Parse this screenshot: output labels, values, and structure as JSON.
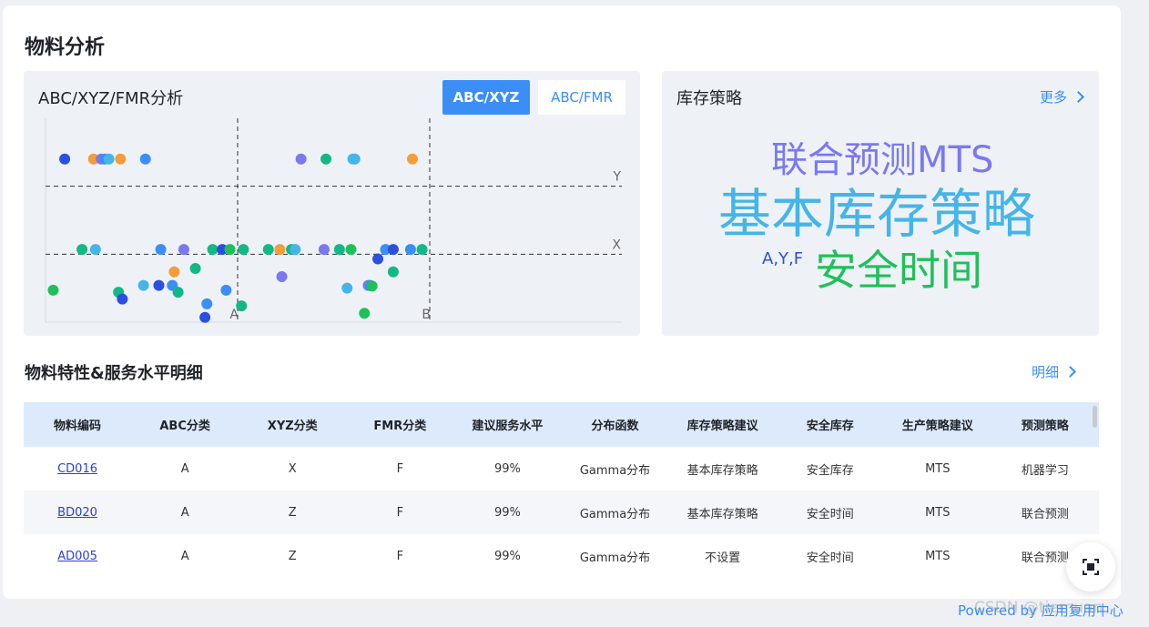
{
  "page": {
    "title": "物料分析"
  },
  "analysis": {
    "title": "ABC/XYZ/FMR分析",
    "tabs": [
      {
        "label": "ABC/XYZ",
        "active": true
      },
      {
        "label": "ABC/FMR",
        "active": false
      }
    ],
    "colors": {
      "active_tab": "#3a8ef6"
    }
  },
  "chart_data": {
    "type": "scatter",
    "x_category_labels": [
      "A",
      "B"
    ],
    "y_category_labels": [
      "X",
      "Y"
    ],
    "x_divider_values": [
      1,
      2
    ],
    "y_divider_values": [
      1,
      2
    ],
    "xlim": [
      0,
      3
    ],
    "ylim": [
      0,
      3
    ],
    "grid": false,
    "point_colors": [
      "#2b4fe0",
      "#3a8ef6",
      "#45b5e8",
      "#7b78f0",
      "#f59c3b",
      "#12b886",
      "#1fc05a"
    ],
    "points": [
      {
        "x": 0.1,
        "y": 2.4,
        "c": 0
      },
      {
        "x": 0.25,
        "y": 2.4,
        "c": 4
      },
      {
        "x": 0.29,
        "y": 2.4,
        "c": 3
      },
      {
        "x": 0.31,
        "y": 2.4,
        "c": 1
      },
      {
        "x": 0.33,
        "y": 2.4,
        "c": 2
      },
      {
        "x": 0.39,
        "y": 2.4,
        "c": 4
      },
      {
        "x": 0.52,
        "y": 2.4,
        "c": 1
      },
      {
        "x": 1.33,
        "y": 2.4,
        "c": 3
      },
      {
        "x": 1.46,
        "y": 2.4,
        "c": 5
      },
      {
        "x": 1.6,
        "y": 2.4,
        "c": 2
      },
      {
        "x": 1.61,
        "y": 2.4,
        "c": 2
      },
      {
        "x": 1.91,
        "y": 2.4,
        "c": 4
      },
      {
        "x": 0.19,
        "y": 1.07,
        "c": 5
      },
      {
        "x": 0.26,
        "y": 1.07,
        "c": 2
      },
      {
        "x": 0.6,
        "y": 1.07,
        "c": 1
      },
      {
        "x": 0.72,
        "y": 1.07,
        "c": 3
      },
      {
        "x": 0.87,
        "y": 1.07,
        "c": 5
      },
      {
        "x": 0.92,
        "y": 1.07,
        "c": 0
      },
      {
        "x": 0.96,
        "y": 1.07,
        "c": 6
      },
      {
        "x": 1.03,
        "y": 1.07,
        "c": 5
      },
      {
        "x": 1.16,
        "y": 1.07,
        "c": 5
      },
      {
        "x": 1.22,
        "y": 1.07,
        "c": 4
      },
      {
        "x": 1.28,
        "y": 1.07,
        "c": 5
      },
      {
        "x": 1.3,
        "y": 1.07,
        "c": 2
      },
      {
        "x": 1.45,
        "y": 1.07,
        "c": 3
      },
      {
        "x": 1.53,
        "y": 1.07,
        "c": 5
      },
      {
        "x": 1.59,
        "y": 1.07,
        "c": 6
      },
      {
        "x": 1.77,
        "y": 1.07,
        "c": 1
      },
      {
        "x": 1.81,
        "y": 1.07,
        "c": 0
      },
      {
        "x": 1.9,
        "y": 1.07,
        "c": 1
      },
      {
        "x": 1.96,
        "y": 1.07,
        "c": 5
      },
      {
        "x": 1.73,
        "y": 0.93,
        "c": 0
      },
      {
        "x": 0.67,
        "y": 0.74,
        "c": 4
      },
      {
        "x": 0.78,
        "y": 0.79,
        "c": 5
      },
      {
        "x": 1.81,
        "y": 0.74,
        "c": 5
      },
      {
        "x": 1.23,
        "y": 0.67,
        "c": 3
      },
      {
        "x": 0.04,
        "y": 0.47,
        "c": 6
      },
      {
        "x": 0.38,
        "y": 0.44,
        "c": 5
      },
      {
        "x": 0.51,
        "y": 0.54,
        "c": 2
      },
      {
        "x": 0.59,
        "y": 0.54,
        "c": 0
      },
      {
        "x": 0.66,
        "y": 0.54,
        "c": 1
      },
      {
        "x": 0.69,
        "y": 0.44,
        "c": 5
      },
      {
        "x": 0.4,
        "y": 0.34,
        "c": 0
      },
      {
        "x": 0.84,
        "y": 0.27,
        "c": 1
      },
      {
        "x": 0.94,
        "y": 0.47,
        "c": 1
      },
      {
        "x": 1.02,
        "y": 0.24,
        "c": 5
      },
      {
        "x": 1.57,
        "y": 0.5,
        "c": 2
      },
      {
        "x": 1.68,
        "y": 0.54,
        "c": 3
      },
      {
        "x": 1.69,
        "y": 0.54,
        "c": 1
      },
      {
        "x": 1.7,
        "y": 0.53,
        "c": 6
      },
      {
        "x": 0.83,
        "y": 0.07,
        "c": 0
      },
      {
        "x": 1.66,
        "y": 0.13,
        "c": 6
      }
    ]
  },
  "strategy": {
    "title": "库存策略",
    "more_label": "更多",
    "words": [
      {
        "text": "联合预测MTS",
        "color": "#7b78f0"
      },
      {
        "text": "基本库存策略",
        "color": "#45b5e8"
      },
      {
        "text": "A,Y,F",
        "color": "#2b4fe0"
      },
      {
        "text": "安全时间",
        "color": "#1fc05a"
      }
    ]
  },
  "details": {
    "title": "物料特性&服务水平明细",
    "link_label": "明细",
    "columns": [
      "物料编码",
      "ABC分类",
      "XYZ分类",
      "FMR分类",
      "建议服务水平",
      "分布函数",
      "库存策略建议",
      "安全库存",
      "生产策略建议",
      "预测策略"
    ],
    "rows": [
      [
        "CD016",
        "A",
        "X",
        "F",
        "99%",
        "Gamma分布",
        "基本库存策略",
        "安全库存",
        "MTS",
        "机器学习"
      ],
      [
        "BD020",
        "A",
        "Z",
        "F",
        "99%",
        "Gamma分布",
        "基本库存策略",
        "安全时间",
        "MTS",
        "联合预测"
      ],
      [
        "AD005",
        "A",
        "Z",
        "F",
        "99%",
        "Gamma分布",
        "不设置",
        "安全时间",
        "MTS",
        "联合预测"
      ]
    ]
  },
  "footer": {
    "powered": "Powered by 应用复用中心",
    "watermark": "CSDN @tiemuan",
    "fab_icon": "fullscreen-icon"
  }
}
